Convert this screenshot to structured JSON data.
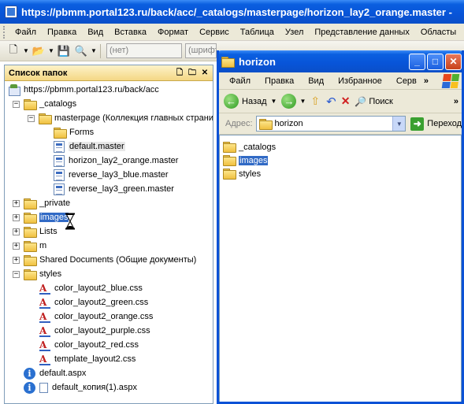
{
  "main_window": {
    "title": "https://pbmm.portal123.ru/back/acc/_catalogs/masterpage/horizon_lay2_orange.master -",
    "menu": [
      "Файл",
      "Правка",
      "Вид",
      "Вставка",
      "Формат",
      "Сервис",
      "Таблица",
      "Узел",
      "Представление данных",
      "Областы"
    ],
    "toolbar": {
      "style_select": "(нет)",
      "font_select": "(шрифт"
    }
  },
  "folder_pane": {
    "header": "Список папок",
    "root": "https://pbmm.portal123.ru/back/acc",
    "catalogs": "_catalogs",
    "masterpage": "masterpage (Коллекция главных страниц)",
    "forms": "Forms",
    "default_master": "default.master",
    "horizon_master": "horizon_lay2_orange.master",
    "reverse_blue": "reverse_lay3_blue.master",
    "reverse_green": "reverse_lay3_green.master",
    "private": "_private",
    "images": "images",
    "lists": "Lists",
    "m": "m",
    "shared_docs": "Shared Documents (Общие документы)",
    "styles": "styles",
    "css_files": [
      "color_layout2_blue.css",
      "color_layout2_green.css",
      "color_layout2_orange.css",
      "color_layout2_purple.css",
      "color_layout2_red.css",
      "template_layout2.css"
    ],
    "default_aspx": "default.aspx",
    "default_copy_aspx": "default_копия(1).aspx"
  },
  "explorer": {
    "title": "horizon",
    "menu": [
      "Файл",
      "Правка",
      "Вид",
      "Избранное",
      "Серв"
    ],
    "menu_overflow": "»",
    "back_label": "Назад",
    "search_label": "Поиск",
    "address_label": "Адрес:",
    "address_value": "horizon",
    "go_label": "Переход",
    "items": [
      "_catalogs",
      "images",
      "styles"
    ]
  },
  "colors": {
    "titlebar": "#0854d8",
    "selection": "#316ac5",
    "pane_header": "#f4d784"
  }
}
